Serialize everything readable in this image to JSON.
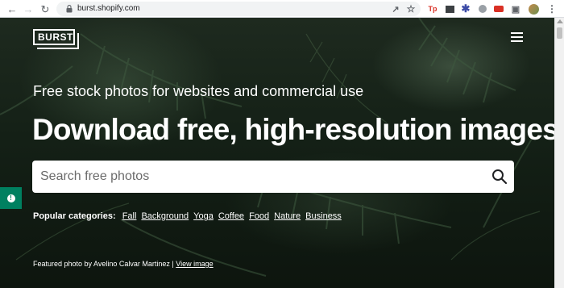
{
  "browser": {
    "url": "burst.shopify.com",
    "back_icon": "arrow-left-icon",
    "forward_icon": "arrow-right-icon",
    "reload_icon": "reload-icon",
    "extensions": [
      {
        "name": "share-icon"
      },
      {
        "name": "star-icon"
      },
      {
        "name": "tp-extension",
        "label": "Tp",
        "color": "#d93025"
      },
      {
        "name": "film-extension"
      },
      {
        "name": "asterisk-extension",
        "color": "#3c4ba6"
      },
      {
        "name": "disc-extension"
      },
      {
        "name": "badge-extension",
        "label": "new",
        "color": "#d93025"
      },
      {
        "name": "puzzle-icon"
      },
      {
        "name": "avatar"
      },
      {
        "name": "kebab-menu-icon"
      }
    ]
  },
  "site": {
    "logo_text": "BURST",
    "menu_icon": "hamburger-icon",
    "subtitle": "Free stock photos for websites and commercial use",
    "headline": "Download free, high-resolution images",
    "search": {
      "placeholder": "Search free photos",
      "value": ""
    },
    "categories": {
      "label": "Popular categories:",
      "items": [
        "Fall",
        "Background",
        "Yoga",
        "Coffee",
        "Food",
        "Nature",
        "Business"
      ]
    },
    "credit": {
      "text": "Featured photo by Avelino Calvar Martinez |",
      "link": "View image"
    }
  },
  "colors": {
    "accent": "#008060",
    "hero_dark": "#142016"
  }
}
